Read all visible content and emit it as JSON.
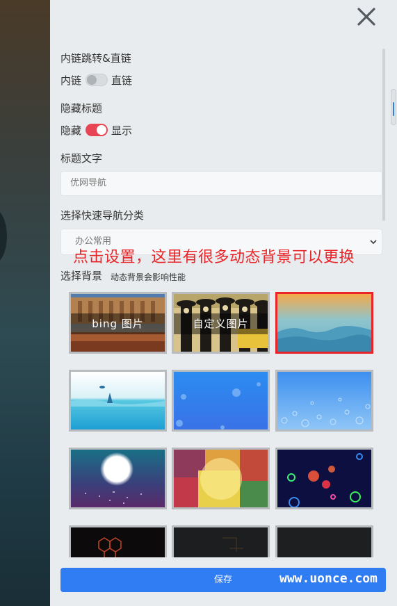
{
  "settings": {
    "link_jump": {
      "title": "内链跳转&直链",
      "off_label": "内链",
      "on_label": "直链",
      "state": "off"
    },
    "hide_title": {
      "title": "隐藏标题",
      "off_label": "隐藏",
      "on_label": "显示",
      "state": "on"
    },
    "title_text": {
      "title": "标题文字",
      "value": "优网导航"
    },
    "quick_nav": {
      "title": "选择快速导航分类",
      "selected": "办公常用"
    },
    "background": {
      "title": "选择背景",
      "hint": "动态背景会影响性能",
      "tiles": [
        {
          "name": "bing",
          "caption": "bing 图片",
          "selected": false
        },
        {
          "name": "custom",
          "caption": "自定义图片",
          "selected": false
        },
        {
          "name": "sunset-waves",
          "caption": "",
          "selected": true
        },
        {
          "name": "ocean-fish",
          "caption": "",
          "selected": false
        },
        {
          "name": "blue-bubbles",
          "caption": "",
          "selected": false
        },
        {
          "name": "light-bubbles",
          "caption": "",
          "selected": false
        },
        {
          "name": "moon-night",
          "caption": "",
          "selected": false
        },
        {
          "name": "color-blocks",
          "caption": "",
          "selected": false
        },
        {
          "name": "neon-rings",
          "caption": "",
          "selected": false
        },
        {
          "name": "hex-network",
          "caption": "",
          "selected": false
        },
        {
          "name": "dark-lines",
          "caption": "",
          "selected": false
        },
        {
          "name": "dark-plain",
          "caption": "",
          "selected": false
        }
      ]
    },
    "save_label": "保存"
  },
  "annotation": "点击设置，这里有很多动态背景可以更换",
  "watermark": "www.uonce.com",
  "colors": {
    "accent_red": "#e8262a",
    "toggle_on": "#e84554",
    "save_blue": "#2f7cf3"
  }
}
